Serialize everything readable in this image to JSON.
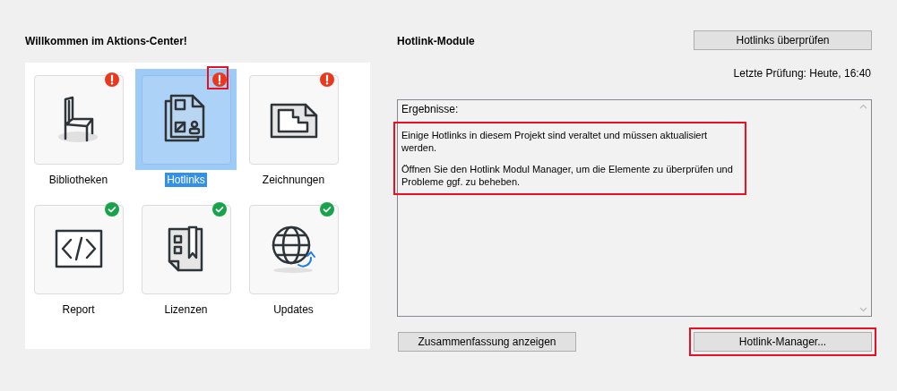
{
  "welcome_title": "Willkommen im Aktions-Center!",
  "tiles": [
    {
      "label": "Bibliotheken",
      "alert": true,
      "selected": false,
      "highlighted": false
    },
    {
      "label": "Hotlinks",
      "alert": true,
      "selected": true,
      "highlighted": true
    },
    {
      "label": "Zeichnungen",
      "alert": true,
      "selected": false,
      "highlighted": false
    },
    {
      "label": "Report",
      "alert": false,
      "selected": false,
      "highlighted": false
    },
    {
      "label": "Lizenzen",
      "alert": false,
      "selected": false,
      "highlighted": false
    },
    {
      "label": "Updates",
      "alert": false,
      "selected": false,
      "highlighted": false
    }
  ],
  "hotlink_panel": {
    "title": "Hotlink-Module",
    "check_button": "Hotlinks überprüfen",
    "last_check": "Letzte Prüfung: Heute, 16:40",
    "results": {
      "heading": "Ergebnisse:",
      "highlighted": true,
      "messages": [
        "Einige Hotlinks in diesem Projekt sind veraltet und müssen aktualisiert werden.",
        "Öffnen Sie den Hotlink Modul Manager, um die Elemente zu überprüfen und Probleme ggf. zu beheben."
      ]
    },
    "buttons": [
      {
        "label": "Zusammenfassung anzeigen",
        "highlighted": false
      },
      {
        "label": "Hotlink-Manager...",
        "highlighted": true
      }
    ]
  }
}
